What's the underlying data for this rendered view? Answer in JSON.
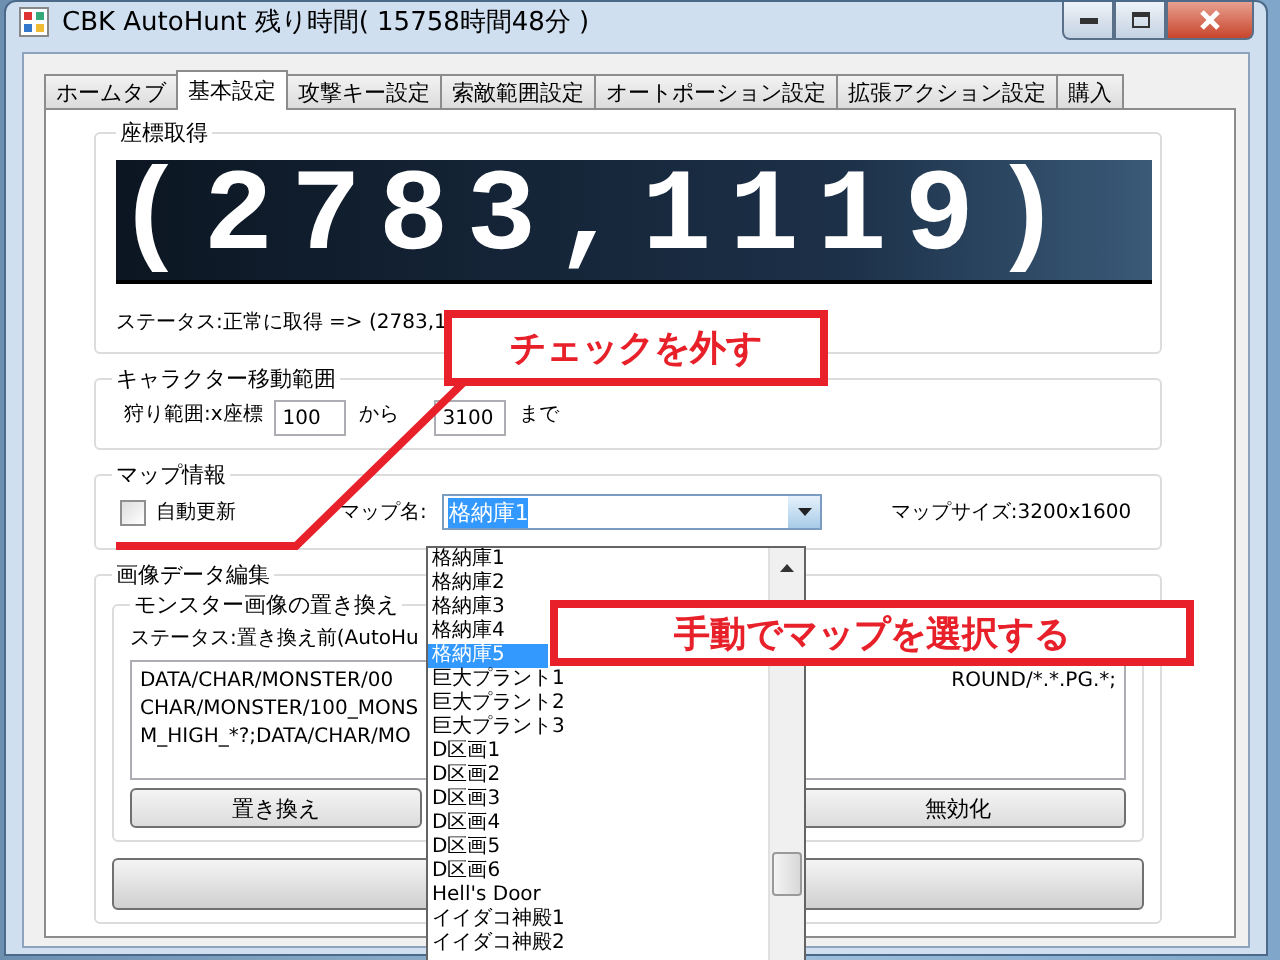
{
  "window": {
    "title": "CBK AutoHunt 残り時間( 15758時間48分 )"
  },
  "tabs": [
    {
      "label": "ホームタブ",
      "selected": false
    },
    {
      "label": "基本設定",
      "selected": true
    },
    {
      "label": "攻撃キー設定",
      "selected": false
    },
    {
      "label": "索敵範囲設定",
      "selected": false
    },
    {
      "label": "オートポーション設定",
      "selected": false
    },
    {
      "label": "拡張アクション設定",
      "selected": false
    },
    {
      "label": "購入",
      "selected": false
    }
  ],
  "coordinate_group": {
    "legend": "座標取得",
    "display": "(2783,1119)",
    "status": "ステータス:正常に取得 => (2783,1"
  },
  "movement_group": {
    "legend": "キャラクター移動範囲",
    "label": "狩り範囲:x座標",
    "from_value": "100",
    "between": "から",
    "to_value": "3100",
    "suffix": "まで"
  },
  "map_group": {
    "legend": "マップ情報",
    "auto_update": {
      "label": "自動更新",
      "checked": false
    },
    "map_label": "マップ名:",
    "map_value": "格納庫1",
    "size_label": "マップサイズ:3200x1600"
  },
  "image_group": {
    "legend": "画像データ編集",
    "subgroup": "モンスター画像の置き換え",
    "status": "ステータス:置き換え前(AutoHu",
    "lines": [
      "DATA/CHAR/MONSTER/00",
      "CHAR/MONSTER/100_MONS",
      "M_HIGH_*?;DATA/CHAR/MO"
    ],
    "line_tail": "ROUND/*.*.PG.*;",
    "buttons": [
      "置き換え",
      "無効化"
    ]
  },
  "dropdown": {
    "items": [
      {
        "label": "格納庫1",
        "selected": false
      },
      {
        "label": "格納庫2",
        "selected": false
      },
      {
        "label": "格納庫3",
        "selected": false
      },
      {
        "label": "格納庫4",
        "selected": false
      },
      {
        "label": "格納庫5",
        "selected": true
      },
      {
        "label": "巨大プラント1",
        "selected": false
      },
      {
        "label": "巨大プラント2",
        "selected": false
      },
      {
        "label": "巨大プラント3",
        "selected": false
      },
      {
        "label": "D区画1",
        "selected": false
      },
      {
        "label": "D区画2",
        "selected": false
      },
      {
        "label": "D区画3",
        "selected": false
      },
      {
        "label": "D区画4",
        "selected": false
      },
      {
        "label": "D区画5",
        "selected": false
      },
      {
        "label": "D区画6",
        "selected": false
      },
      {
        "label": "Hell's Door",
        "selected": false
      },
      {
        "label": "イイダコ神殿1",
        "selected": false
      },
      {
        "label": "イイダコ神殿2",
        "selected": false
      }
    ]
  },
  "callouts": [
    {
      "text": "チェックを外す"
    },
    {
      "text": "手動でマップを選択する"
    }
  ]
}
